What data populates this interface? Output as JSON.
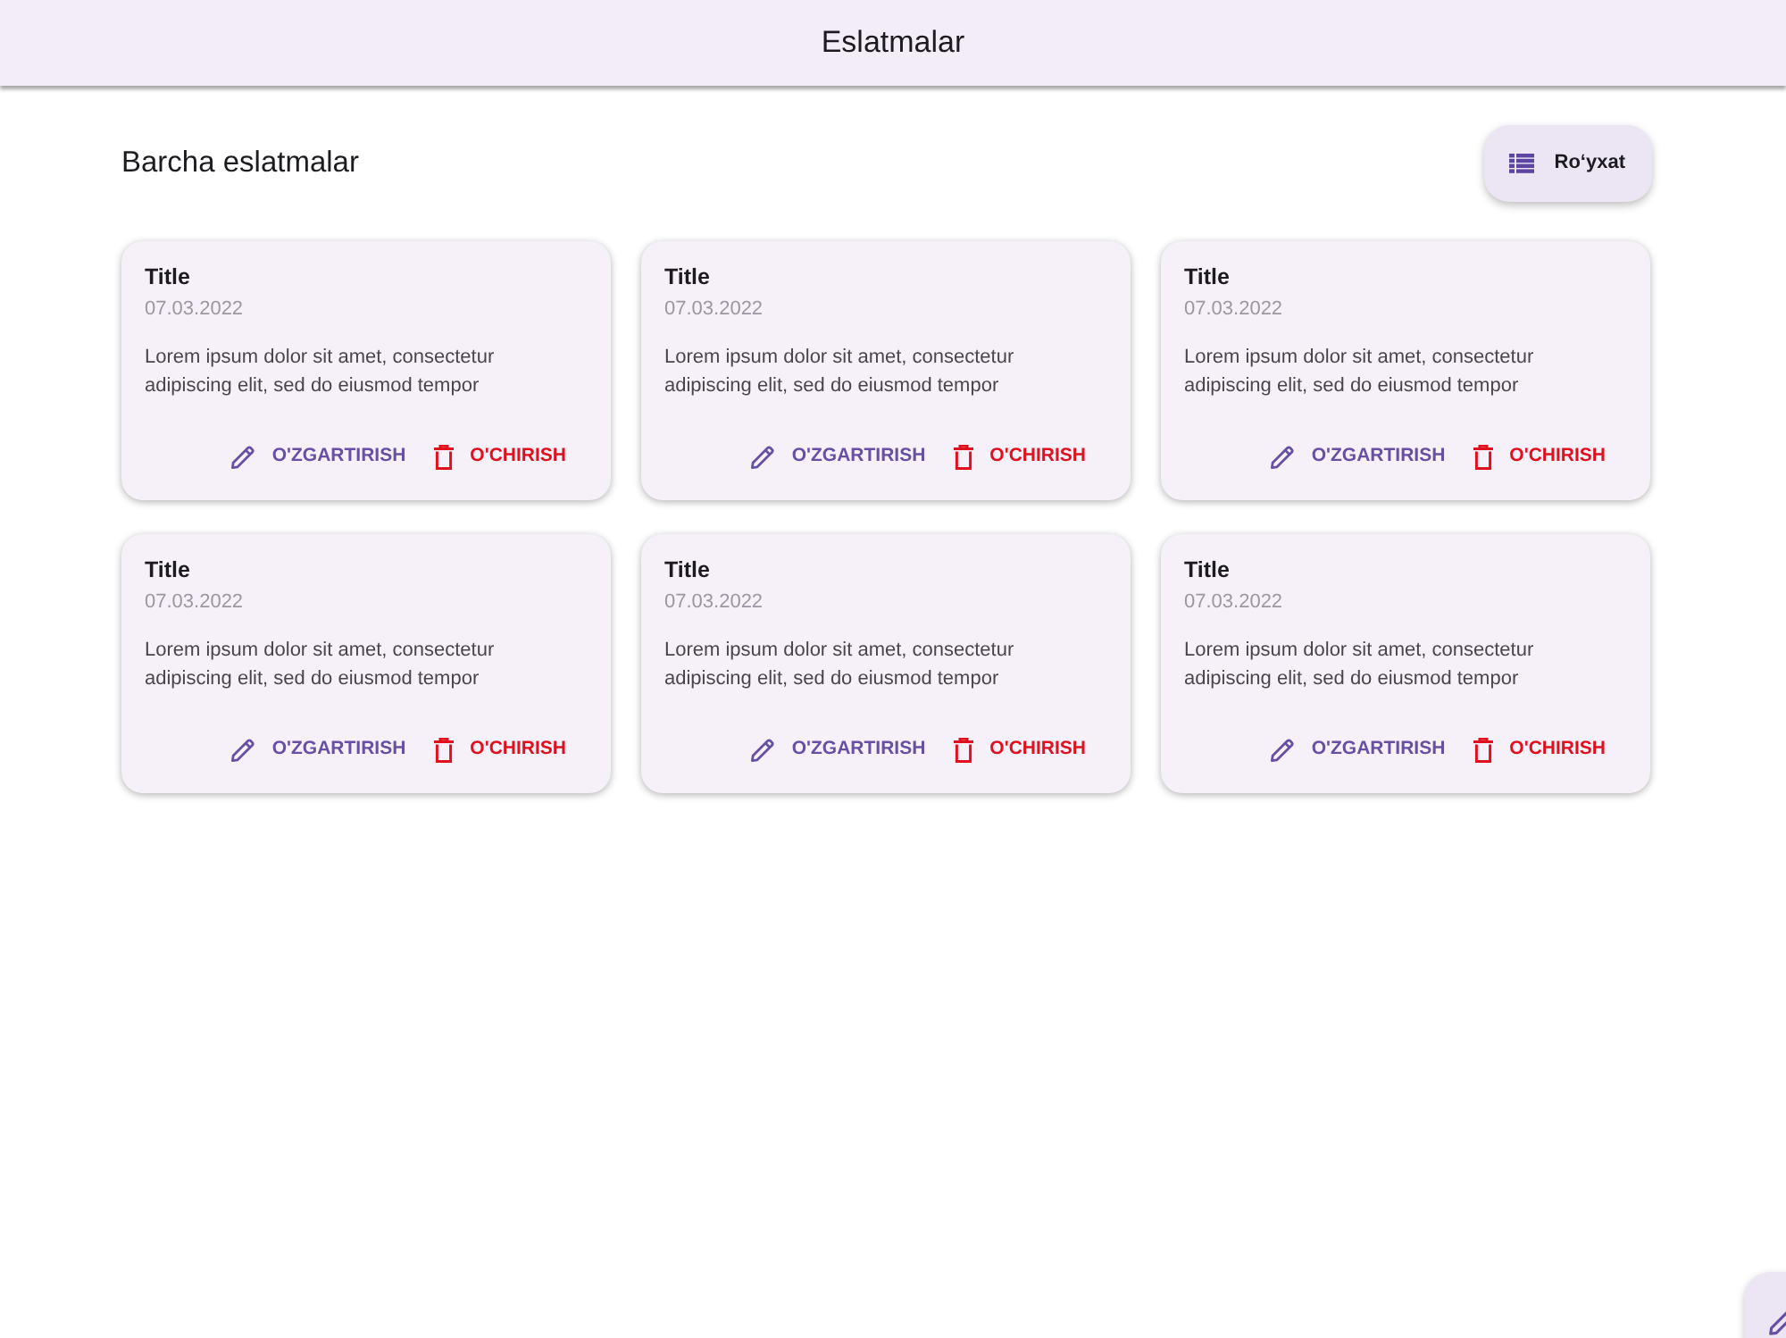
{
  "app_bar": {
    "title": "Eslatmalar"
  },
  "page": {
    "heading": "Barcha eslatmalar",
    "view_button": {
      "label": "Ro‘yxat"
    }
  },
  "notes": [
    {
      "title": "Title",
      "date": "07.03.2022",
      "text": "Lorem ipsum dolor sit amet, consectetur adipiscing elit, sed do eiusmod tempor",
      "actions": [
        {
          "kind": "edit",
          "label": "O'ZGARTIRISH"
        },
        {
          "kind": "delete",
          "label": "O'CHIRISH"
        }
      ]
    },
    {
      "title": "Title",
      "date": "07.03.2022",
      "text": "Lorem ipsum dolor sit amet, consectetur adipiscing elit, sed do eiusmod tempor",
      "actions": [
        {
          "kind": "edit",
          "label": "O'ZGARTIRISH"
        },
        {
          "kind": "delete",
          "label": "O'CHIRISH"
        }
      ]
    },
    {
      "title": "Title",
      "date": "07.03.2022",
      "text": "Lorem ipsum dolor sit amet, consectetur adipiscing elit, sed do eiusmod tempor",
      "actions": [
        {
          "kind": "edit",
          "label": "O'ZGARTIRISH"
        },
        {
          "kind": "delete",
          "label": "O'CHIRISH"
        }
      ]
    },
    {
      "title": "Title",
      "date": "07.03.2022",
      "text": "Lorem ipsum dolor sit amet, consectetur adipiscing elit, sed do eiusmod tempor",
      "actions": [
        {
          "kind": "edit",
          "label": "O'ZGARTIRISH"
        },
        {
          "kind": "delete",
          "label": "O'CHIRISH"
        }
      ]
    },
    {
      "title": "Title",
      "date": "07.03.2022",
      "text": "Lorem ipsum dolor sit amet, consectetur adipiscing elit, sed do eiusmod tempor",
      "actions": [
        {
          "kind": "edit",
          "label": "O'ZGARTIRISH"
        },
        {
          "kind": "delete",
          "label": "O'CHIRISH"
        }
      ]
    },
    {
      "title": "Title",
      "date": "07.03.2022",
      "text": "Lorem ipsum dolor sit amet, consectetur adipiscing elit, sed do eiusmod tempor",
      "actions": [
        {
          "kind": "edit",
          "label": "O'ZGARTIRISH"
        },
        {
          "kind": "delete",
          "label": "O'CHIRISH"
        }
      ]
    }
  ],
  "fab": {
    "kind": "edit"
  }
}
